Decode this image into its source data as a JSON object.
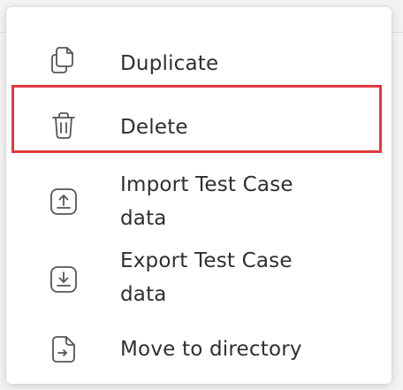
{
  "menu": {
    "items": [
      {
        "label": "Duplicate",
        "icon": "duplicate-icon"
      },
      {
        "label": "Delete",
        "icon": "trash-icon",
        "highlighted": true
      },
      {
        "label": "Import Test Case\ndata",
        "icon": "import-icon"
      },
      {
        "label": "Export Test Case\ndata",
        "icon": "export-icon"
      },
      {
        "label": "Move to directory",
        "icon": "move-file-icon"
      }
    ]
  },
  "colors": {
    "highlight_border": "#e0393e",
    "text": "#2f2f2f",
    "icon": "#555555",
    "menu_background": "#ffffff"
  }
}
